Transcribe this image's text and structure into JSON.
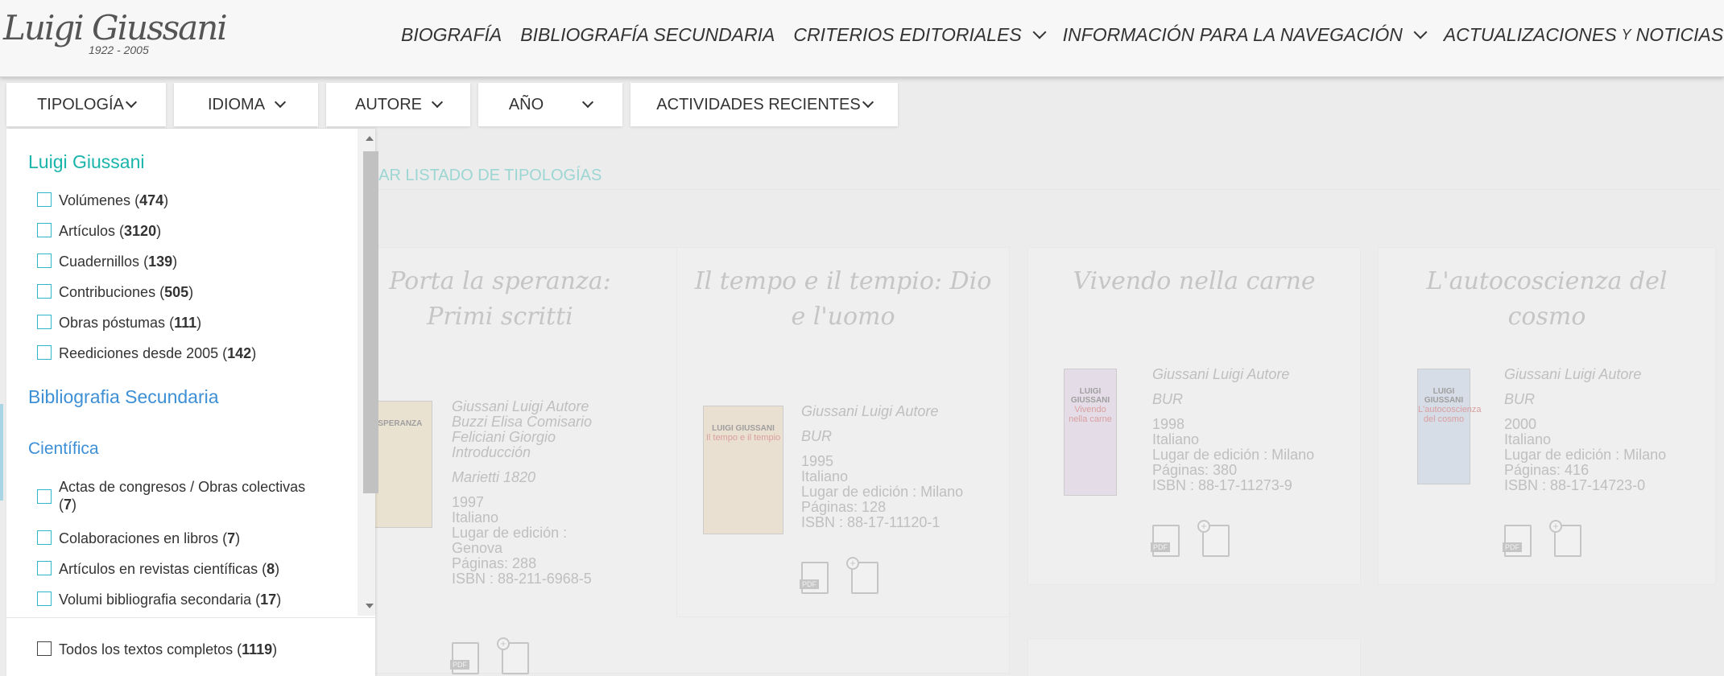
{
  "header": {
    "logo_signature": "Luigi Giussani",
    "logo_years": "1922 - 2005",
    "nav": [
      {
        "label": "BIOGRAFÍA",
        "has_dropdown": false
      },
      {
        "label": "BIBLIOGRAFÍA SECUNDARIA",
        "has_dropdown": false
      },
      {
        "label": "CRITERIOS EDITORIALES",
        "has_dropdown": true
      },
      {
        "label": "INFORMACIÓN PARA LA NAVEGACIÓN",
        "has_dropdown": true
      }
    ],
    "nav_last": {
      "part1": "ACTUALIZACIONES",
      "part2": "Y",
      "part3": "NOTICIAS"
    }
  },
  "filters": [
    {
      "label": "TIPOLOGÍA"
    },
    {
      "label": "IDIOMA"
    },
    {
      "label": "AUTORE"
    },
    {
      "label": "AÑO"
    },
    {
      "label": "ACTIVIDADES RECIENTES"
    }
  ],
  "dropdown": {
    "section1_title": "Luigi Giussani",
    "section1_items": [
      {
        "label": "Volúmenes",
        "count": "474"
      },
      {
        "label": "Artículos",
        "count": "3120"
      },
      {
        "label": "Cuadernillos",
        "count": "139"
      },
      {
        "label": "Contribuciones",
        "count": "505"
      },
      {
        "label": "Obras póstumas",
        "count": "111"
      },
      {
        "label": "Reediciones desde 2005",
        "count": "142"
      }
    ],
    "section2_title": "Bibliografia Secundaria",
    "section3_title": "Científica",
    "section3_items": [
      {
        "label": "Actas de congresos / Obras colectivas",
        "count": "7"
      },
      {
        "label": "Colaboraciones en libros ",
        "count": "7"
      },
      {
        "label": "Artículos en revistas científicas ",
        "count": "8"
      },
      {
        "label": "Volumi bibliografia secondaria",
        "count": "17"
      }
    ],
    "footer_item": {
      "label": "Todos los textos completos",
      "count": "1119"
    }
  },
  "background": {
    "reset_link": "ZAR LISTADO DE TIPOLOGÍAS",
    "cards": [
      {
        "title": "Porta la speranza: Primi scritti",
        "cover_title": "LA SPERANZA",
        "lines_italic": [
          "Giussani Luigi Autore",
          "Buzzi Elisa Comisario",
          "Feliciani Giorgio",
          "Introducción",
          "Marietti 1820"
        ],
        "lines": [
          "1997",
          "Italiano",
          "Lugar de edición :",
          "Genova",
          "Páginas: 288",
          "ISBN : 88-211-6968-5"
        ]
      },
      {
        "title": "Il tempo e il tempio: Dio e l'uomo",
        "cover_title": "LUIGI GIUSSANI",
        "cover_sub": "Il tempo e il tempio",
        "lines_italic": [
          "Giussani Luigi Autore",
          "BUR"
        ],
        "lines": [
          "1995",
          "Italiano",
          "Lugar de edición : Milano",
          "Páginas: 128",
          "ISBN : 88-17-11120-1"
        ]
      },
      {
        "title": "Vivendo nella carne",
        "cover_title": "LUIGI GIUSSANI",
        "cover_sub": "Vivendo nella carne",
        "lines_italic": [
          "Giussani Luigi Autore",
          "BUR"
        ],
        "lines": [
          "1998",
          "Italiano",
          "Lugar de edición : Milano",
          "Páginas: 380",
          "ISBN : 88-17-11273-9"
        ]
      },
      {
        "title": "L'autocoscienza del cosmo",
        "cover_title": "LUIGI GIUSSANI",
        "cover_sub": "L'autocoscienza del cosmo",
        "lines_italic": [
          "Giussani Luigi Autore",
          "BUR"
        ],
        "lines": [
          "2000",
          "Italiano",
          "Lugar de edición : Milano",
          "Páginas: 416",
          "ISBN : 88-17-14723-0"
        ]
      }
    ],
    "pdf_label": "PDF"
  }
}
